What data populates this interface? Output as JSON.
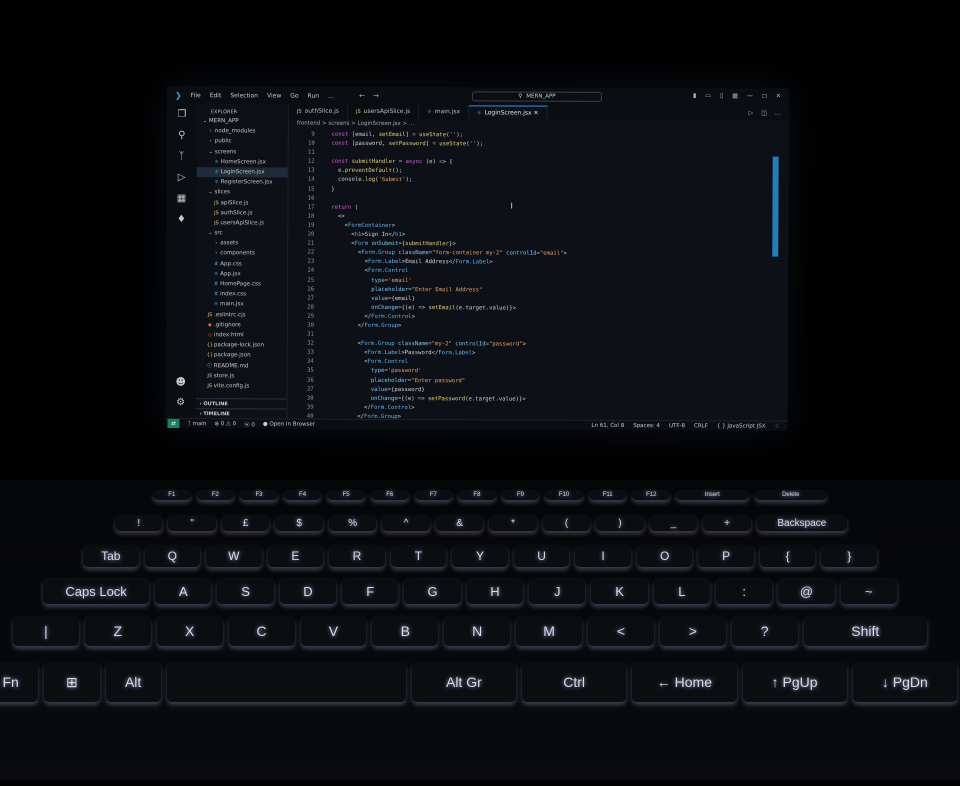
{
  "titlebar": {
    "menus": [
      "File",
      "Edit",
      "Selection",
      "View",
      "Go",
      "Run",
      "…"
    ],
    "search": "MERN_APP",
    "window_controls": [
      "layout-icon",
      "layout-icon",
      "layout-icon",
      "layout-icon",
      "minimize-icon",
      "maximize-icon",
      "close-icon"
    ]
  },
  "sidebar": {
    "header": "EXPLORER",
    "items": [
      {
        "label": "MERN_APP",
        "depth": 0,
        "kind": "folder-open"
      },
      {
        "label": "node_modules",
        "depth": 1,
        "kind": "folder"
      },
      {
        "label": "public",
        "depth": 1,
        "kind": "folder"
      },
      {
        "label": "screens",
        "depth": 1,
        "kind": "folder-open"
      },
      {
        "label": "HomeScreen.jsx",
        "depth": 2,
        "kind": "jsx"
      },
      {
        "label": "LoginScreen.jsx",
        "depth": 2,
        "kind": "jsx",
        "selected": true
      },
      {
        "label": "RegisterScreen.jsx",
        "depth": 2,
        "kind": "jsx"
      },
      {
        "label": "slices",
        "depth": 1,
        "kind": "folder-open"
      },
      {
        "label": "apiSlice.js",
        "depth": 2,
        "kind": "js"
      },
      {
        "label": "authSlice.js",
        "depth": 2,
        "kind": "js"
      },
      {
        "label": "usersApiSlice.js",
        "depth": 2,
        "kind": "js"
      },
      {
        "label": "src",
        "depth": 1,
        "kind": "folder-open"
      },
      {
        "label": "assets",
        "depth": 2,
        "kind": "folder"
      },
      {
        "label": "components",
        "depth": 2,
        "kind": "folder"
      },
      {
        "label": "App.css",
        "depth": 2,
        "kind": "css"
      },
      {
        "label": "App.jsx",
        "depth": 2,
        "kind": "jsx"
      },
      {
        "label": "HomePage.css",
        "depth": 2,
        "kind": "css"
      },
      {
        "label": "index.css",
        "depth": 2,
        "kind": "css"
      },
      {
        "label": "main.jsx",
        "depth": 2,
        "kind": "jsx"
      },
      {
        "label": ".eslintrc.cjs",
        "depth": 1,
        "kind": "js"
      },
      {
        "label": ".gitignore",
        "depth": 1,
        "kind": "git"
      },
      {
        "label": "index.html",
        "depth": 1,
        "kind": "html"
      },
      {
        "label": "package-lock.json",
        "depth": 1,
        "kind": "json"
      },
      {
        "label": "package.json",
        "depth": 1,
        "kind": "json"
      },
      {
        "label": "README.md",
        "depth": 1,
        "kind": "md"
      },
      {
        "label": "store.js",
        "depth": 1,
        "kind": "js"
      },
      {
        "label": "vite.config.js",
        "depth": 1,
        "kind": "js"
      }
    ],
    "outline": "OUTLINE",
    "timeline": "TIMELINE"
  },
  "tabs": [
    {
      "label": "authSlice.js",
      "active": false
    },
    {
      "label": "usersApiSlice.js",
      "active": false
    },
    {
      "label": "main.jsx",
      "active": false
    },
    {
      "label": "LoginScreen.jsx",
      "active": true
    }
  ],
  "breadcrumb": "frontend  >  screens  >  LoginScreen.jsx  >  …",
  "code": [
    {
      "n": "9",
      "text": "  const [email, setEmail] = useState('');"
    },
    {
      "n": "10",
      "text": "  const [password, setPassword] = useState('');"
    },
    {
      "n": "11",
      "text": ""
    },
    {
      "n": "12",
      "text": "  const submitHandler = async (e) => {"
    },
    {
      "n": "13",
      "text": "    e.preventDefault();"
    },
    {
      "n": "14",
      "text": "    console.log('Submit');"
    },
    {
      "n": "15",
      "text": "  }"
    },
    {
      "n": "16",
      "text": ""
    },
    {
      "n": "17",
      "text": "  return ("
    },
    {
      "n": "18",
      "text": "    <>"
    },
    {
      "n": "19",
      "text": "      <FormContainer>"
    },
    {
      "n": "20",
      "text": "        <h1>Sign In</h1>"
    },
    {
      "n": "21",
      "text": "        <Form onSubmit={submitHandler}>"
    },
    {
      "n": "22",
      "text": "          <Form.Group className=\"form-container my-2\" controlId=\"email\">"
    },
    {
      "n": "23",
      "text": "            <Form.Label>Email Address</Form.Label>"
    },
    {
      "n": "24",
      "text": "            <Form.Control"
    },
    {
      "n": "25",
      "text": "              type='email'"
    },
    {
      "n": "26",
      "text": "              placeholder=\"Enter Email Address\""
    },
    {
      "n": "27",
      "text": "              value={email}"
    },
    {
      "n": "28",
      "text": "              onChange={(e) => setEmail(e.target.value)}>"
    },
    {
      "n": "29",
      "text": "            </Form.Control>"
    },
    {
      "n": "30",
      "text": "          </Form.Group>"
    },
    {
      "n": "31",
      "text": ""
    },
    {
      "n": "32",
      "text": "          <Form.Group className=\"my-2\" controlId=\"password\">"
    },
    {
      "n": "33",
      "text": "            <Form.Label>Password</Form.Label>"
    },
    {
      "n": "34",
      "text": "            <Form.Control"
    },
    {
      "n": "35",
      "text": "              type='password'"
    },
    {
      "n": "36",
      "text": "              placeholder=\"Enter password\""
    },
    {
      "n": "37",
      "text": "              value={password}"
    },
    {
      "n": "38",
      "text": "              onChange={(e) => setPassword(e.target.value)}>"
    },
    {
      "n": "39",
      "text": "            </Form.Control>"
    },
    {
      "n": "40",
      "text": "          </Form.Group>"
    }
  ],
  "statusbar": {
    "branch": "main",
    "problems": "⊗ 0 ⚠ 0",
    "ports": "ⓦ 0",
    "open_browser": "Open In Browser",
    "position": "Ln 61, Col 8",
    "spaces": "Spaces: 4",
    "encoding": "UTF-8",
    "eol": "CRLF",
    "language": "JavaScript JSX"
  },
  "keyboard": {
    "rows": [
      [
        "F1",
        "F2",
        "F3",
        "F4",
        "F5",
        "F6",
        "F7",
        "F8",
        "F9",
        "F10",
        "F11",
        "F12",
        "Insert",
        "Delete"
      ],
      [
        "!",
        "\"",
        "£",
        "$",
        "%",
        "^",
        "&",
        "*",
        "(",
        ")",
        "_",
        "+",
        "Backspace"
      ],
      [
        "Tab",
        "Q",
        "W",
        "E",
        "R",
        "T",
        "Y",
        "U",
        "I",
        "O",
        "P",
        "{",
        "}"
      ],
      [
        "Caps Lock",
        "A",
        "S",
        "D",
        "F",
        "G",
        "H",
        "J",
        "K",
        "L",
        ":",
        "@",
        "~"
      ],
      [
        "|",
        "Z",
        "X",
        "C",
        "V",
        "B",
        "N",
        "M",
        "<",
        ">",
        "?",
        "Shift"
      ],
      [
        "Fn",
        "⊞",
        "Alt",
        "",
        "Alt Gr",
        "Ctrl",
        "← Home",
        "↑ PgUp",
        "↓ PgDn"
      ]
    ]
  }
}
